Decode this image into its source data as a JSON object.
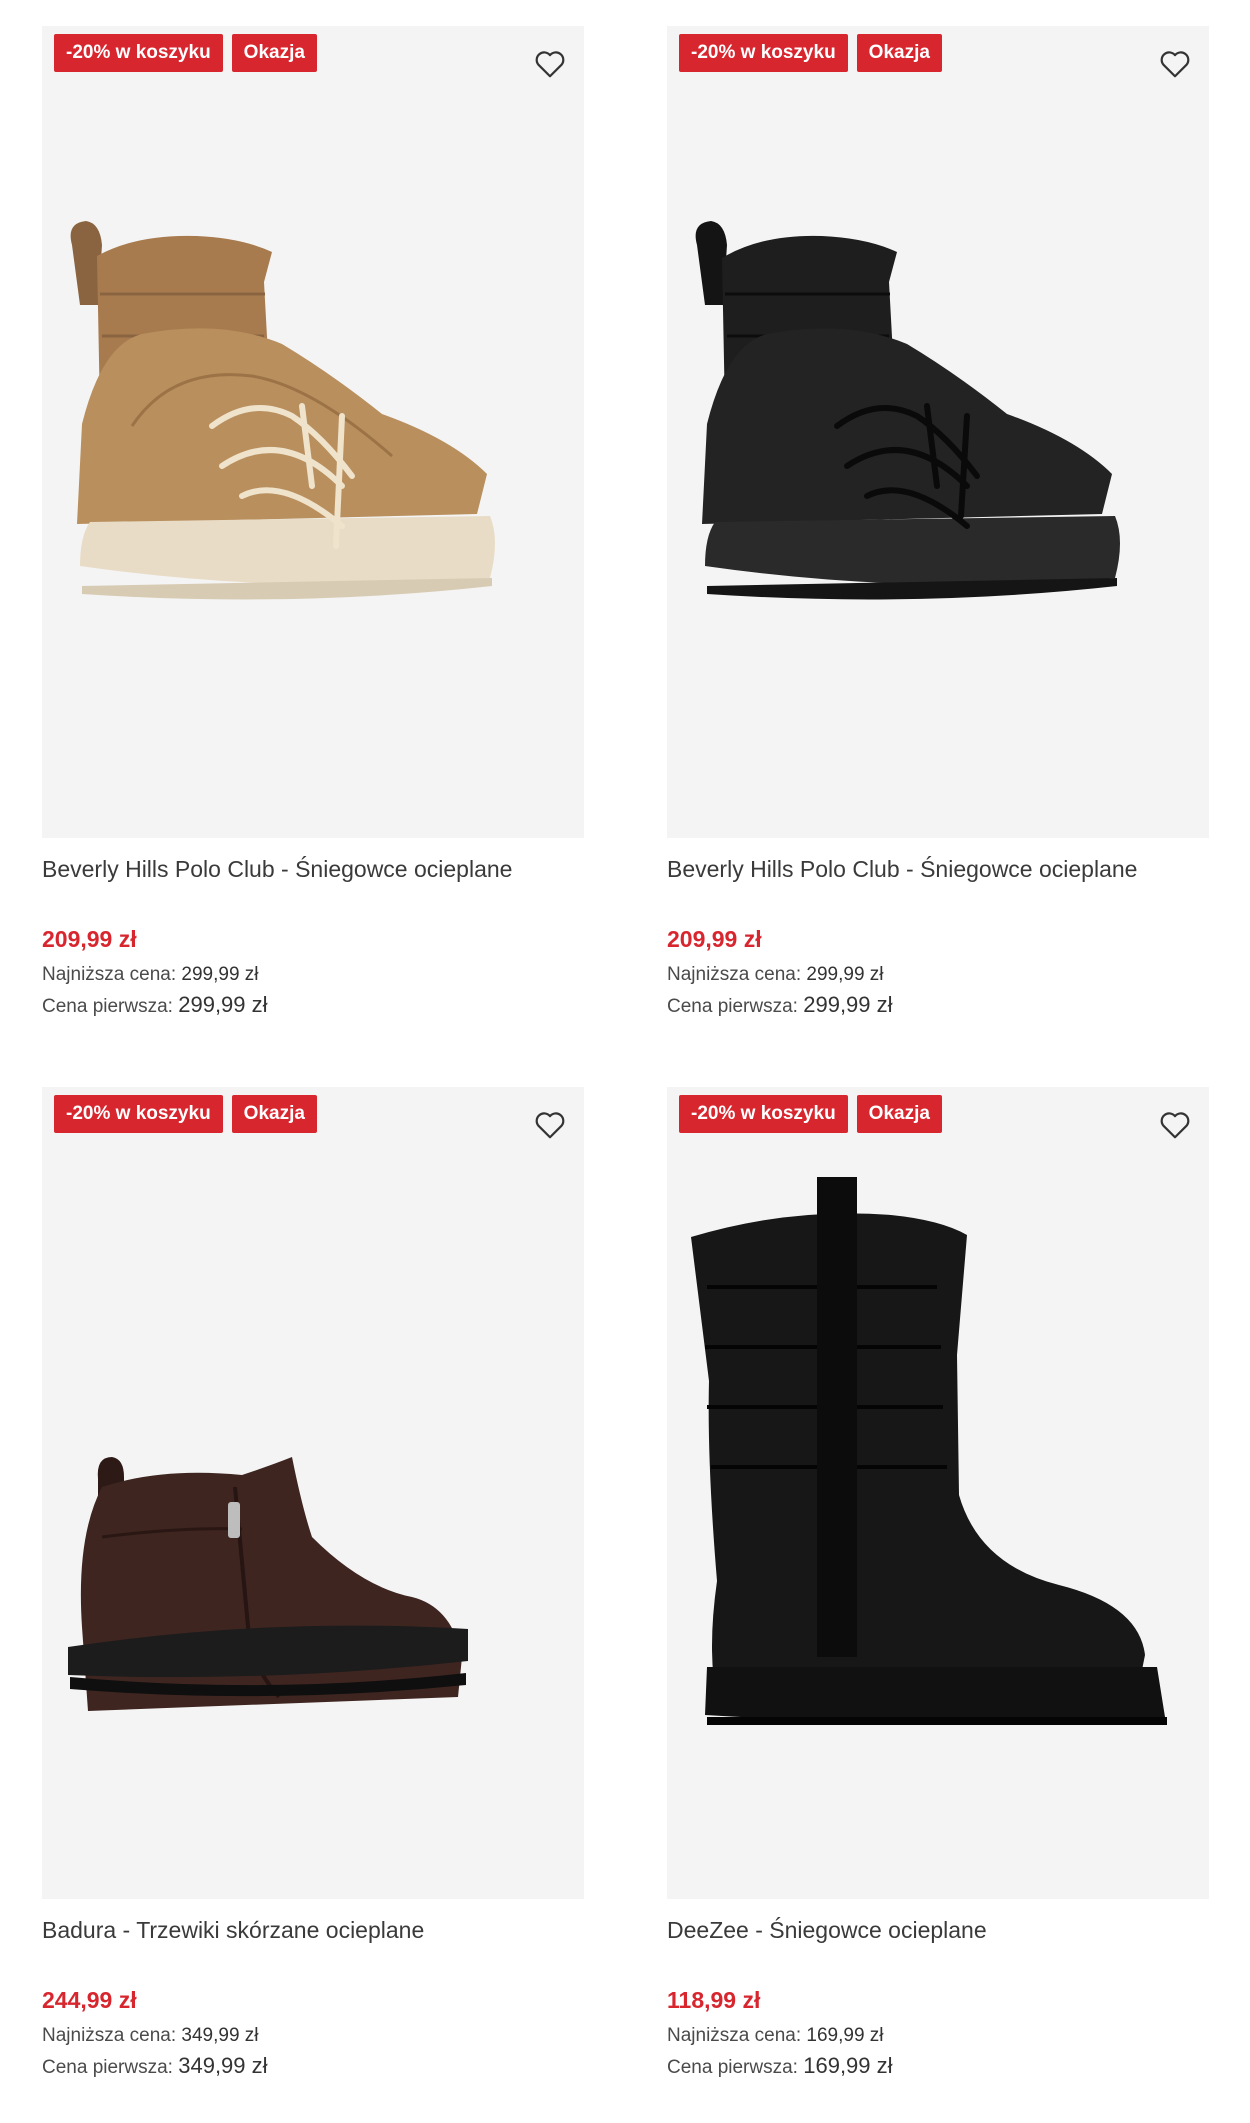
{
  "products": [
    {
      "badges": [
        "-20% w koszyku",
        "Okazja"
      ],
      "title": "Beverly Hills Polo Club - Śniegowce ocieplane",
      "price": "209,99 zł",
      "lowest_label": "Najniższa cena:",
      "lowest_value": "299,99 zł",
      "original_label": "Cena pierwsza:",
      "original_value": "299,99 zł",
      "image": "tan-snow-boot",
      "colors": {
        "upper": "#a87b4f",
        "sole": "#e8dcc6",
        "lace": "#efe3cb"
      }
    },
    {
      "badges": [
        "-20% w koszyku",
        "Okazja"
      ],
      "title": "Beverly Hills Polo Club - Śniegowce ocieplane",
      "price": "209,99 zł",
      "lowest_label": "Najniższa cena:",
      "lowest_value": "299,99 zł",
      "original_label": "Cena pierwsza:",
      "original_value": "299,99 zł",
      "image": "black-snow-boot",
      "colors": {
        "upper": "#1e1e1e",
        "sole": "#2a2a2a",
        "lace": "#111111"
      }
    },
    {
      "badges": [
        "-20% w koszyku",
        "Okazja"
      ],
      "title": "Badura - Trzewiki skórzane ocieplane",
      "price": "244,99 zł",
      "lowest_label": "Najniższa cena:",
      "lowest_value": "349,99 zł",
      "original_label": "Cena pierwsza:",
      "original_value": "349,99 zł",
      "image": "brown-leather-ankle-boot",
      "colors": {
        "upper": "#3e2520",
        "sole": "#1c1c1c"
      }
    },
    {
      "badges": [
        "-20% w koszyku",
        "Okazja"
      ],
      "title": "DeeZee - Śniegowce ocieplane",
      "price": "118,99 zł",
      "lowest_label": "Najniższa cena:",
      "lowest_value": "169,99 zł",
      "original_label": "Cena pierwsza:",
      "original_value": "169,99 zł",
      "image": "black-quilted-tall-boot",
      "colors": {
        "upper": "#171717",
        "sole": "#111111"
      }
    }
  ],
  "colors": {
    "accent": "#d8262f",
    "card_bg": "#f4f4f4"
  }
}
